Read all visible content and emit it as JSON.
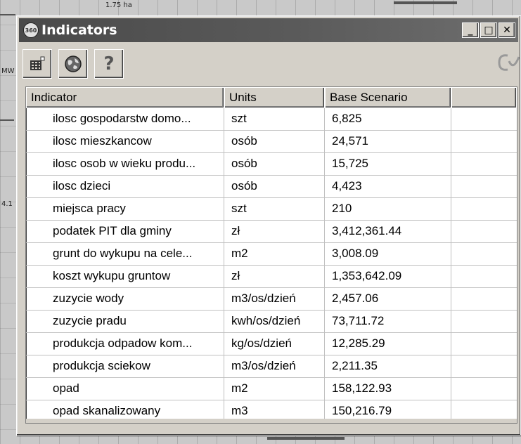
{
  "window": {
    "title": "Indicators",
    "title_icon_text": "360"
  },
  "window_controls": {
    "minimize": "_",
    "maximize": "□",
    "close": "✕"
  },
  "background": {
    "label_a": "1.75 ha",
    "label_b": "MW",
    "label_c": "4.1"
  },
  "toolbar": {
    "buttons": [
      {
        "name": "table-export-button",
        "icon": "table-icon"
      },
      {
        "name": "globe-button",
        "icon": "globe-icon"
      },
      {
        "name": "help-button",
        "icon": "question-icon",
        "glyph": "?"
      }
    ]
  },
  "table": {
    "headers": [
      "Indicator",
      "Units",
      "Base Scenario",
      ""
    ],
    "rows": [
      [
        "ilosc gospodarstw domo...",
        "szt",
        "6,825"
      ],
      [
        "ilosc mieszkancow",
        "osób",
        "24,571"
      ],
      [
        "ilosc osob w wieku produ...",
        "osób",
        "15,725"
      ],
      [
        "ilosc dzieci",
        "osób",
        "4,423"
      ],
      [
        "miejsca pracy",
        "szt",
        "210"
      ],
      [
        "podatek PIT dla gminy",
        "zł",
        "3,412,361.44"
      ],
      [
        "grunt do wykupu na cele...",
        "m2",
        "3,008.09"
      ],
      [
        "koszt wykupu gruntow",
        "zł",
        "1,353,642.09"
      ],
      [
        "zuzycie wody",
        "m3/os/dzień",
        "2,457.06"
      ],
      [
        "zuzycie pradu",
        "kwh/os/dzień",
        "73,711.72"
      ],
      [
        "produkcja odpadow kom...",
        "kg/os/dzień",
        "12,285.29"
      ],
      [
        "produkcja sciekow",
        "m3/os/dzień",
        "2,211.35"
      ],
      [
        "opad",
        "m2",
        "158,122.93"
      ],
      [
        "opad skanalizowany",
        "m3",
        "150,216.79"
      ]
    ]
  }
}
